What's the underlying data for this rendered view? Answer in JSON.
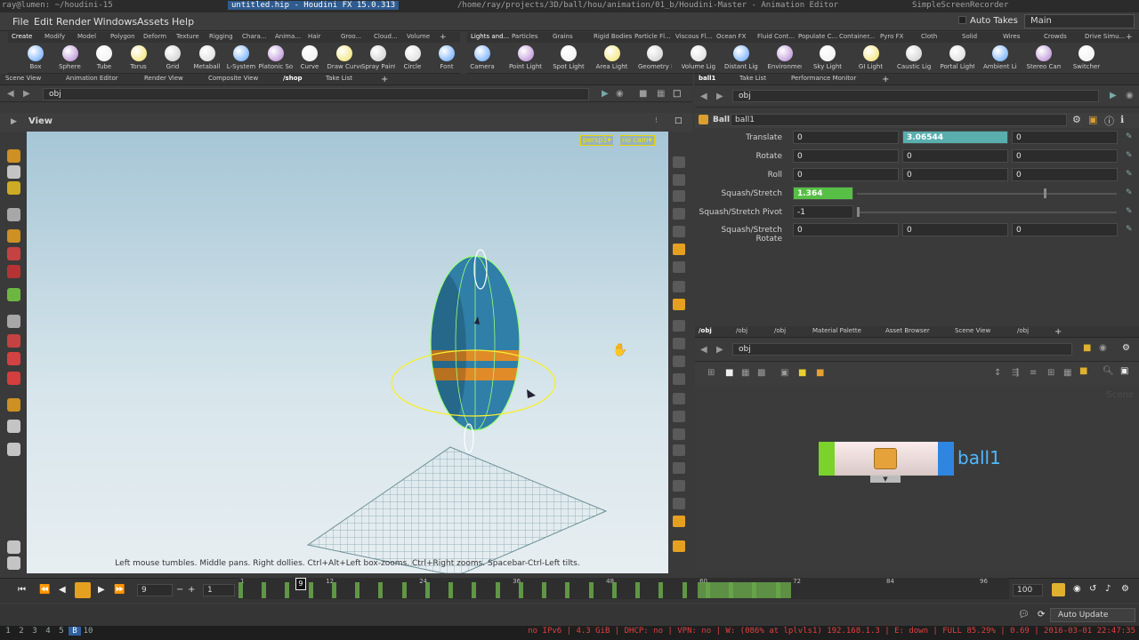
{
  "titlebar": {
    "left": "ray@lumen: ~/houdini-15",
    "active": "untitled.hip - Houdini FX 15.0.313",
    "path": "/home/ray/projects/3D/ball/hou/animation/01_b/Houdini-Master - Animation Editor",
    "right": "SimpleScreenRecorder"
  },
  "menu": {
    "items": [
      "File",
      "Edit",
      "Render",
      "Windows",
      "Assets",
      "Help"
    ],
    "auto_takes": "Auto Takes",
    "take": "Main"
  },
  "shelfA": {
    "tabs": [
      "Create",
      "Modify",
      "Model",
      "Polygon",
      "Deform",
      "Texture",
      "Rigging",
      "Chara...",
      "Anima...",
      "Hair",
      "Groo...",
      "Cloud...",
      "Volume"
    ],
    "tools": [
      "Box",
      "Sphere",
      "Tube",
      "Torus",
      "Grid",
      "Metaball",
      "L-System",
      "Platonic Sol...",
      "Curve",
      "Draw Curve",
      "Spray Paint",
      "Circle",
      "Font"
    ]
  },
  "shelfB": {
    "tabs": [
      "Lights and...",
      "Particles",
      "Grains",
      "Rigid Bodies",
      "Particle Fl...",
      "Viscous Fl...",
      "Ocean FX",
      "Fluid Cont...",
      "Populate C...",
      "Container...",
      "Pyro FX",
      "Cloth",
      "Solid",
      "Wires",
      "Crowds",
      "Drive Simu..."
    ],
    "tools": [
      "Camera",
      "Point Light",
      "Spot Light",
      "Area Light",
      "Geometry L...",
      "Volume Light",
      "Distant Light",
      "Environmen...",
      "Sky Light",
      "GI Light",
      "Caustic Light",
      "Portal Light",
      "Ambient Lig...",
      "Stereo Cam...",
      "Switcher"
    ]
  },
  "left_tabs": [
    "Scene View",
    "Animation Editor",
    "Render View",
    "Composite View",
    "/shop",
    "Take List"
  ],
  "left_path": "obj",
  "view": {
    "label": "View",
    "cam_persp": "persp1▾",
    "cam_nocam": "no cam▾",
    "hint": "Left mouse tumbles. Middle pans. Right dollies. Ctrl+Alt+Left box-zooms. Ctrl+Right zooms. Spacebar-Ctrl-Left tilts."
  },
  "right_tabs": [
    "ball1",
    "Take List",
    "Performance Monitor"
  ],
  "param_path": "obj",
  "node": {
    "type": "Ball",
    "name": "ball1"
  },
  "params": [
    {
      "label": "Translate",
      "values": [
        "0",
        "3.06544",
        "0"
      ]
    },
    {
      "label": "Rotate",
      "values": [
        "0",
        "0",
        "0"
      ]
    },
    {
      "label": "Roll",
      "values": [
        "0",
        "0",
        "0"
      ]
    },
    {
      "label": "Squash/Stretch",
      "values": [
        "1.364"
      ],
      "slider": 0.72
    },
    {
      "label": "Squash/Stretch Pivot",
      "values": [
        "-1"
      ],
      "slider": 0.0
    },
    {
      "label": "Squash/Stretch Rotate",
      "values": [
        "0",
        "0",
        "0"
      ]
    }
  ],
  "net_tabs": [
    "/obj",
    "/obj",
    "/obj",
    "Material Palette",
    "Asset Browser",
    "Scene View",
    "/obj"
  ],
  "net_path": "obj",
  "net_node": {
    "name": "ball1"
  },
  "net_corner": "Scene",
  "timeline": {
    "current": "9",
    "start": "1",
    "end": "100",
    "ticks": [
      "1",
      "12",
      "24",
      "36",
      "48",
      "60",
      "72",
      "84",
      "96"
    ],
    "ticks_frames": [
      1,
      12,
      24,
      36,
      48,
      60,
      72,
      84,
      96
    ],
    "current_frame": 9,
    "range": [
      1,
      100
    ]
  },
  "status": {
    "auto_update": "Auto Update"
  },
  "taskbar": {
    "desktops": [
      "1",
      "2",
      "3",
      "4",
      "5",
      "B",
      "10"
    ],
    "info": "no IPv6 | 4.3 GiB | DHCP: no | VPN: no | W: (086% at lplvls1) 192.168.1.3 | E: down | FULL 85.29% | 0.69 | 2016-03-01 22:47:35"
  }
}
